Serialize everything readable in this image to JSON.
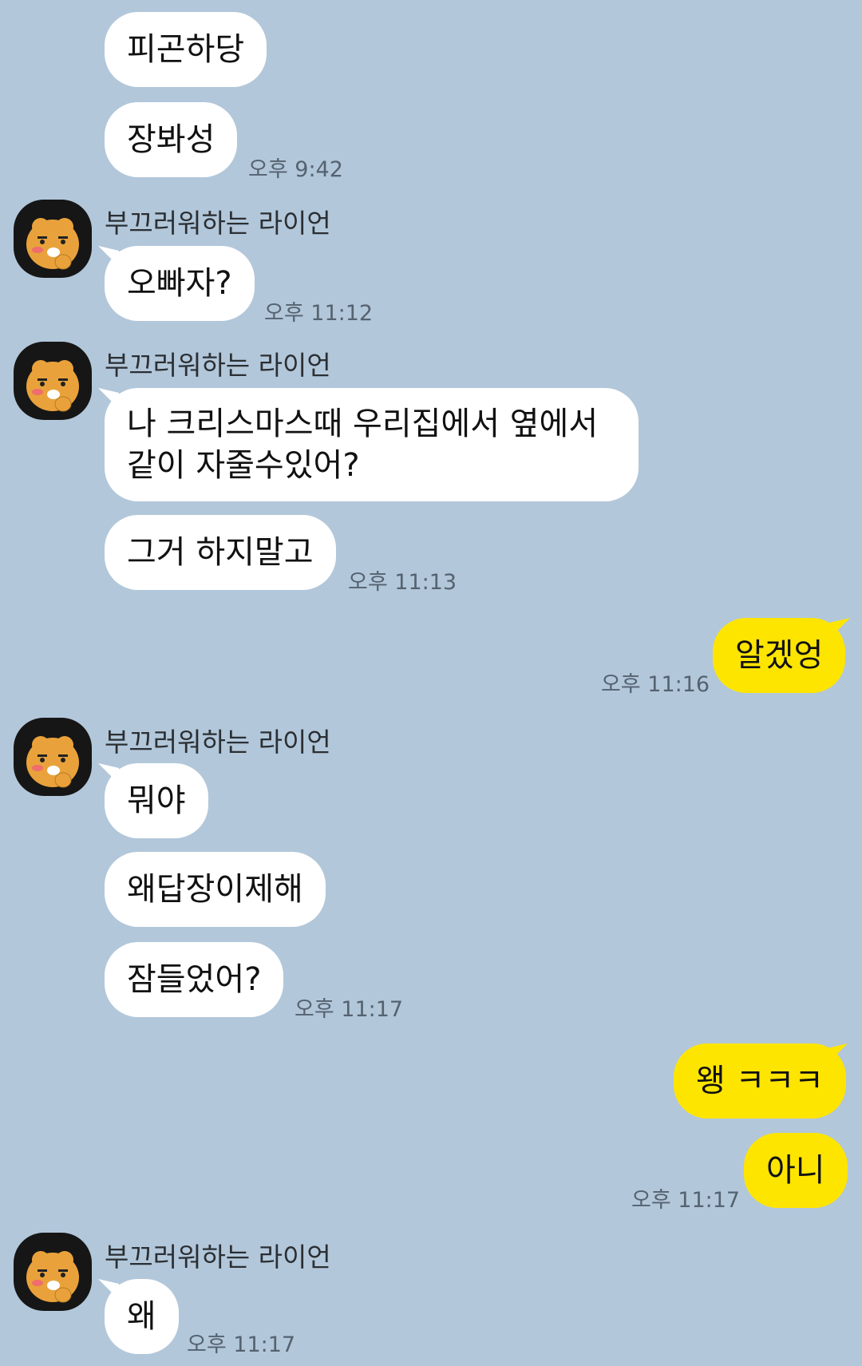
{
  "sender_name": "부끄러워하는 라이언",
  "messages": {
    "m1": "피곤하당",
    "m2": "장봐성",
    "t1": "오후 9:42",
    "m3": "오빠자?",
    "t2": "오후 11:12",
    "m4_line1": "나 크리스마스때 우리집에서 옆에서",
    "m4_line2": "같이 자줄수있어?",
    "m5": "그거 하지말고",
    "t3": "오후 11:13",
    "o1": "알겠엉",
    "t4": "오후 11:16",
    "m6": "뭐야",
    "m7": "왜답장이제해",
    "m8": "잠들었어?",
    "t5": "오후 11:17",
    "o2": "왱 ㅋㅋㅋ",
    "o3": "아니",
    "t6": "오후 11:17",
    "m9": "왜",
    "t7": "오후 11:17"
  },
  "colors": {
    "background": "#b2c7da",
    "incoming_bubble": "#ffffff",
    "outgoing_bubble": "#fee500",
    "avatar_bg": "#161616",
    "avatar_face": "#e9a23b"
  },
  "icons": {
    "avatar": "ryan-character-icon"
  }
}
